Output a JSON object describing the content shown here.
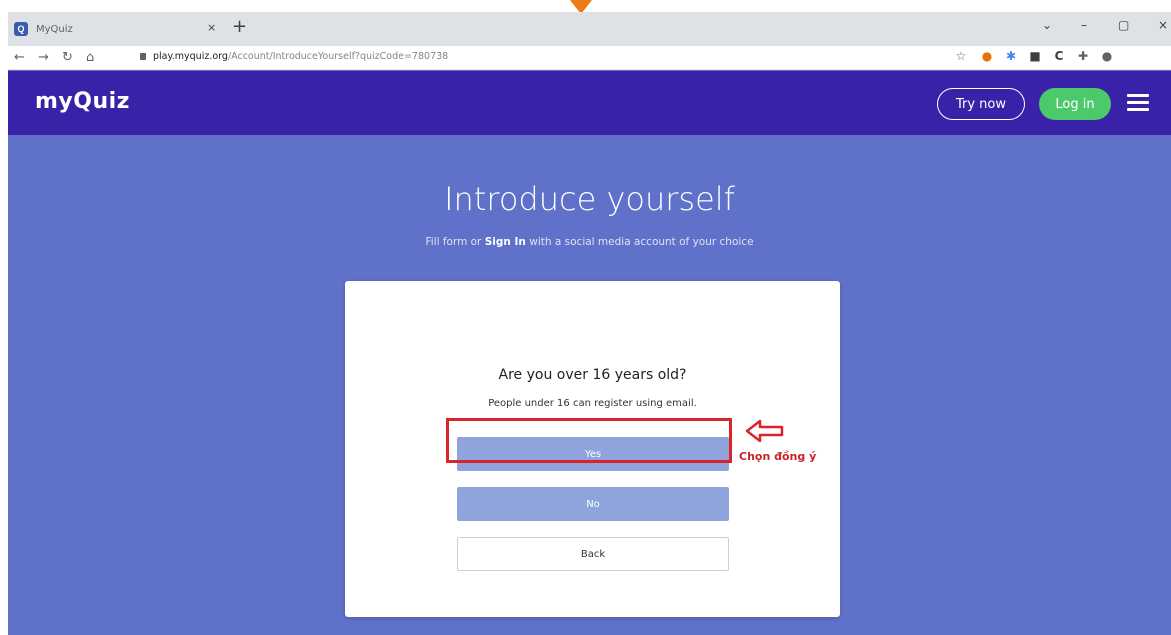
{
  "browser": {
    "tab_title": "MyQuiz",
    "tab_close": "×",
    "new_tab": "+",
    "url_domain": "play.myquiz.org",
    "url_path": "/Account/IntroduceYourself?quizCode=780738",
    "window_controls": [
      "⌄",
      "–",
      "▢",
      "×"
    ]
  },
  "header": {
    "logo": "myQuiz",
    "try_now_label": "Try now",
    "login_label": "Log in"
  },
  "page": {
    "title": "Introduce yourself",
    "subtitle_before": "Fill form or ",
    "subtitle_bold": "Sign In",
    "subtitle_after": " with a social media account of your choice"
  },
  "card": {
    "question": "Are you over 16 years old?",
    "hint": "People under 16 can register using email.",
    "yes_label": "Yes",
    "no_label": "No",
    "back_label": "Back"
  },
  "annotation": {
    "text": "Chọn đồng ý",
    "color": "#d9242a"
  },
  "colors": {
    "page_bg": "#5f71c9",
    "header_bg": "#3a22a8",
    "login_green": "#4cc96b",
    "button_blue": "#8fa4dc"
  }
}
